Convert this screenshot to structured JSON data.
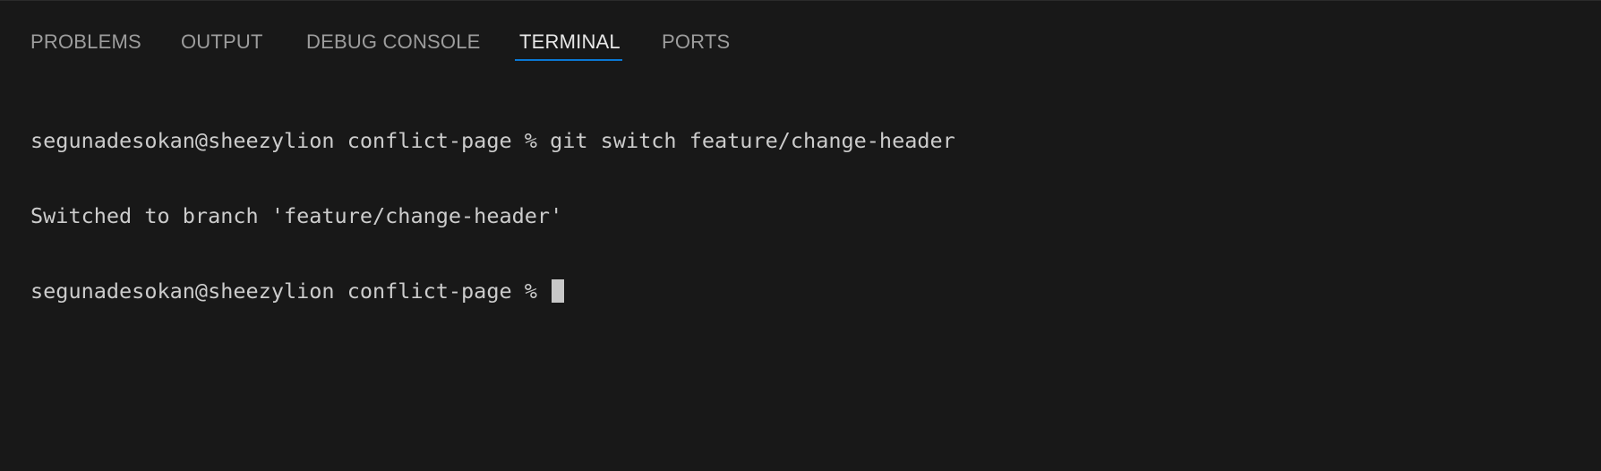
{
  "tabs": [
    {
      "label": "PROBLEMS",
      "active": false
    },
    {
      "label": "OUTPUT",
      "active": false
    },
    {
      "label": "DEBUG CONSOLE",
      "active": false
    },
    {
      "label": "TERMINAL",
      "active": true
    },
    {
      "label": "PORTS",
      "active": false
    }
  ],
  "terminal": {
    "lines": [
      "segunadesokan@sheezylion conflict-page % git switch feature/change-header",
      "Switched to branch 'feature/change-header'",
      "segunadesokan@sheezylion conflict-page % "
    ]
  },
  "colors": {
    "background": "#181818",
    "active_tab_text": "#e7e7e7",
    "inactive_tab_text": "#9d9d9d",
    "active_tab_underline": "#0a78d4",
    "terminal_text": "#cccccc"
  }
}
